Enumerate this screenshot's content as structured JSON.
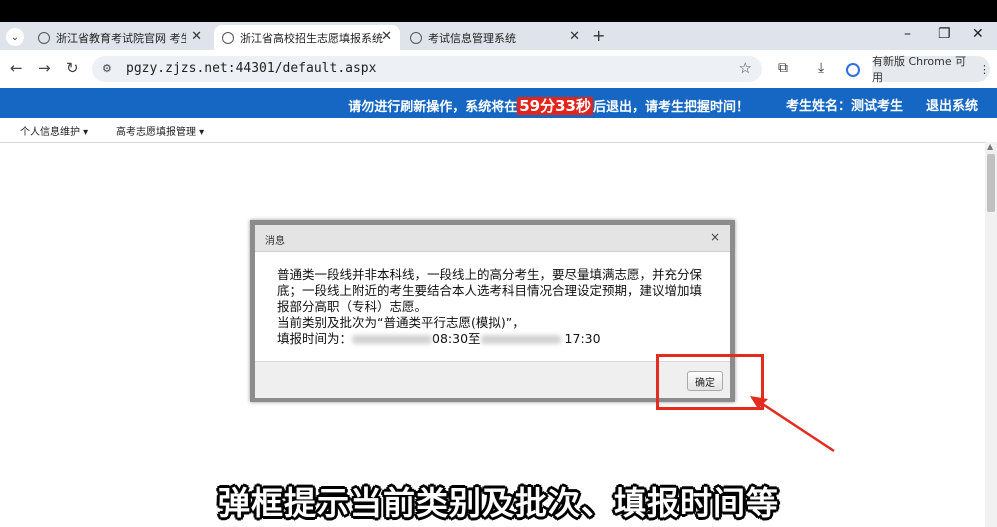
{
  "browser": {
    "tabs": [
      {
        "label": "浙江省教育考试院官网 考生办事",
        "active": false
      },
      {
        "label": "浙江省高校招生志愿填报系统",
        "active": true
      },
      {
        "label": "考试信息管理系统",
        "active": false
      }
    ],
    "new_tab": "+",
    "url": "pgzy.zjzs.net:44301/default.aspx",
    "update_label": "有新版 Chrome 可用",
    "window_controls": {
      "minimize": "–",
      "restore": "❐",
      "close": "✕"
    }
  },
  "banner": {
    "warning_prefix": "请勿进行刷新操作，系统将在",
    "timer": "59分33秒",
    "warning_suffix": "后退出，请考生把握时间！",
    "student_label": "考生姓名：测试考生",
    "logout": "退出系统"
  },
  "menu": {
    "items": [
      {
        "label": "个人信息维护 ▾"
      },
      {
        "label": "高考志愿填报管理 ▾"
      }
    ]
  },
  "dialog": {
    "title": "消息",
    "close": "×",
    "message_lines": [
      "普通类一段线并非本科线，一段线上的高分考生，要尽量填满志愿，并充分保",
      "底；一段线上附近的考生要结合本人选考科目情况合理设定预期，建议增加填",
      "报部分高职（专科）志愿。",
      "当前类别及批次为“普通类平行志愿(模拟)”，"
    ],
    "time_label": "填报时间为：",
    "start_time": "08:30至",
    "end_time": "17:30",
    "confirm": "确定"
  },
  "subtitle": "弹框提示当前类别及批次、填报时间等",
  "colors": {
    "banner": "#1667c3",
    "timer_bg": "#e1251b",
    "annotation": "#e32b1e"
  }
}
